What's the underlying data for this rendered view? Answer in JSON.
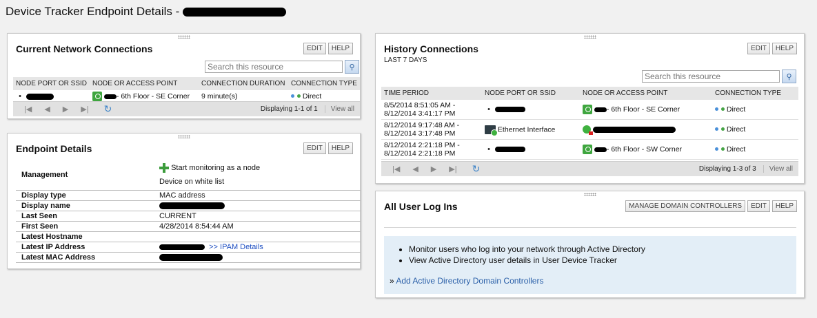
{
  "page": {
    "title": "Device Tracker Endpoint Details - "
  },
  "current": {
    "title": "Current Network Connections",
    "edit": "EDIT",
    "help": "HELP",
    "search_placeholder": "Search this resource",
    "columns": [
      "NODE PORT OR SSID",
      "NODE OR ACCESS POINT",
      "CONNECTION DURATION",
      "CONNECTION TYPE"
    ],
    "rows": [
      {
        "port": "",
        "ap": "- 6th Floor - SE Corner",
        "duration": "9 minute(s)",
        "type": "Direct"
      }
    ],
    "displaying": "Displaying 1-1 of 1",
    "view_all": "View all"
  },
  "endpoint": {
    "title": "Endpoint Details",
    "edit": "EDIT",
    "help": "HELP",
    "management_label": "Management",
    "start_monitoring": "Start monitoring as a node",
    "white_list": "Device on white list",
    "rows": [
      {
        "key": "Display type",
        "value": "MAC address"
      },
      {
        "key": "Display name",
        "value": ""
      },
      {
        "key": "Last Seen",
        "value": "CURRENT"
      },
      {
        "key": "First Seen",
        "value": "4/28/2014 8:54:44 AM"
      },
      {
        "key": "Latest Hostname",
        "value": ""
      },
      {
        "key": "Latest IP Address",
        "value": ""
      },
      {
        "key": "Latest MAC Address",
        "value": ""
      }
    ],
    "ipam_link": ">> IPAM Details"
  },
  "history": {
    "title": "History Connections",
    "subtitle": "LAST 7 DAYS",
    "edit": "EDIT",
    "help": "HELP",
    "search_placeholder": "Search this resource",
    "columns": [
      "TIME PERIOD",
      "NODE PORT OR SSID",
      "NODE OR ACCESS POINT",
      "CONNECTION TYPE"
    ],
    "rows": [
      {
        "t1": "8/5/2014 8:51:05 AM -",
        "t2": "8/12/2014 3:41:17 PM",
        "port": "",
        "ap": "- 6th Floor - SE Corner",
        "type": "Direct"
      },
      {
        "t1": "8/12/2014 9:17:48 AM -",
        "t2": "8/12/2014 3:17:48 PM",
        "port": "Ethernet Interface",
        "ap": "",
        "type": "Direct"
      },
      {
        "t1": "8/12/2014 2:21:18 PM -",
        "t2": "8/12/2014 2:21:18 PM",
        "port": "",
        "ap": "- 6th Floor - SW Corner",
        "type": "Direct"
      }
    ],
    "displaying": "Displaying 1-3 of 3",
    "view_all": "View all"
  },
  "logins": {
    "title": "All User Log Ins",
    "manage": "MANAGE DOMAIN CONTROLLERS",
    "edit": "EDIT",
    "help": "HELP",
    "bullets": [
      "Monitor users who log into your network through Active Directory",
      "View Active Directory user details in User Device Tracker"
    ],
    "add_link": "Add Active Directory Domain Controllers"
  }
}
